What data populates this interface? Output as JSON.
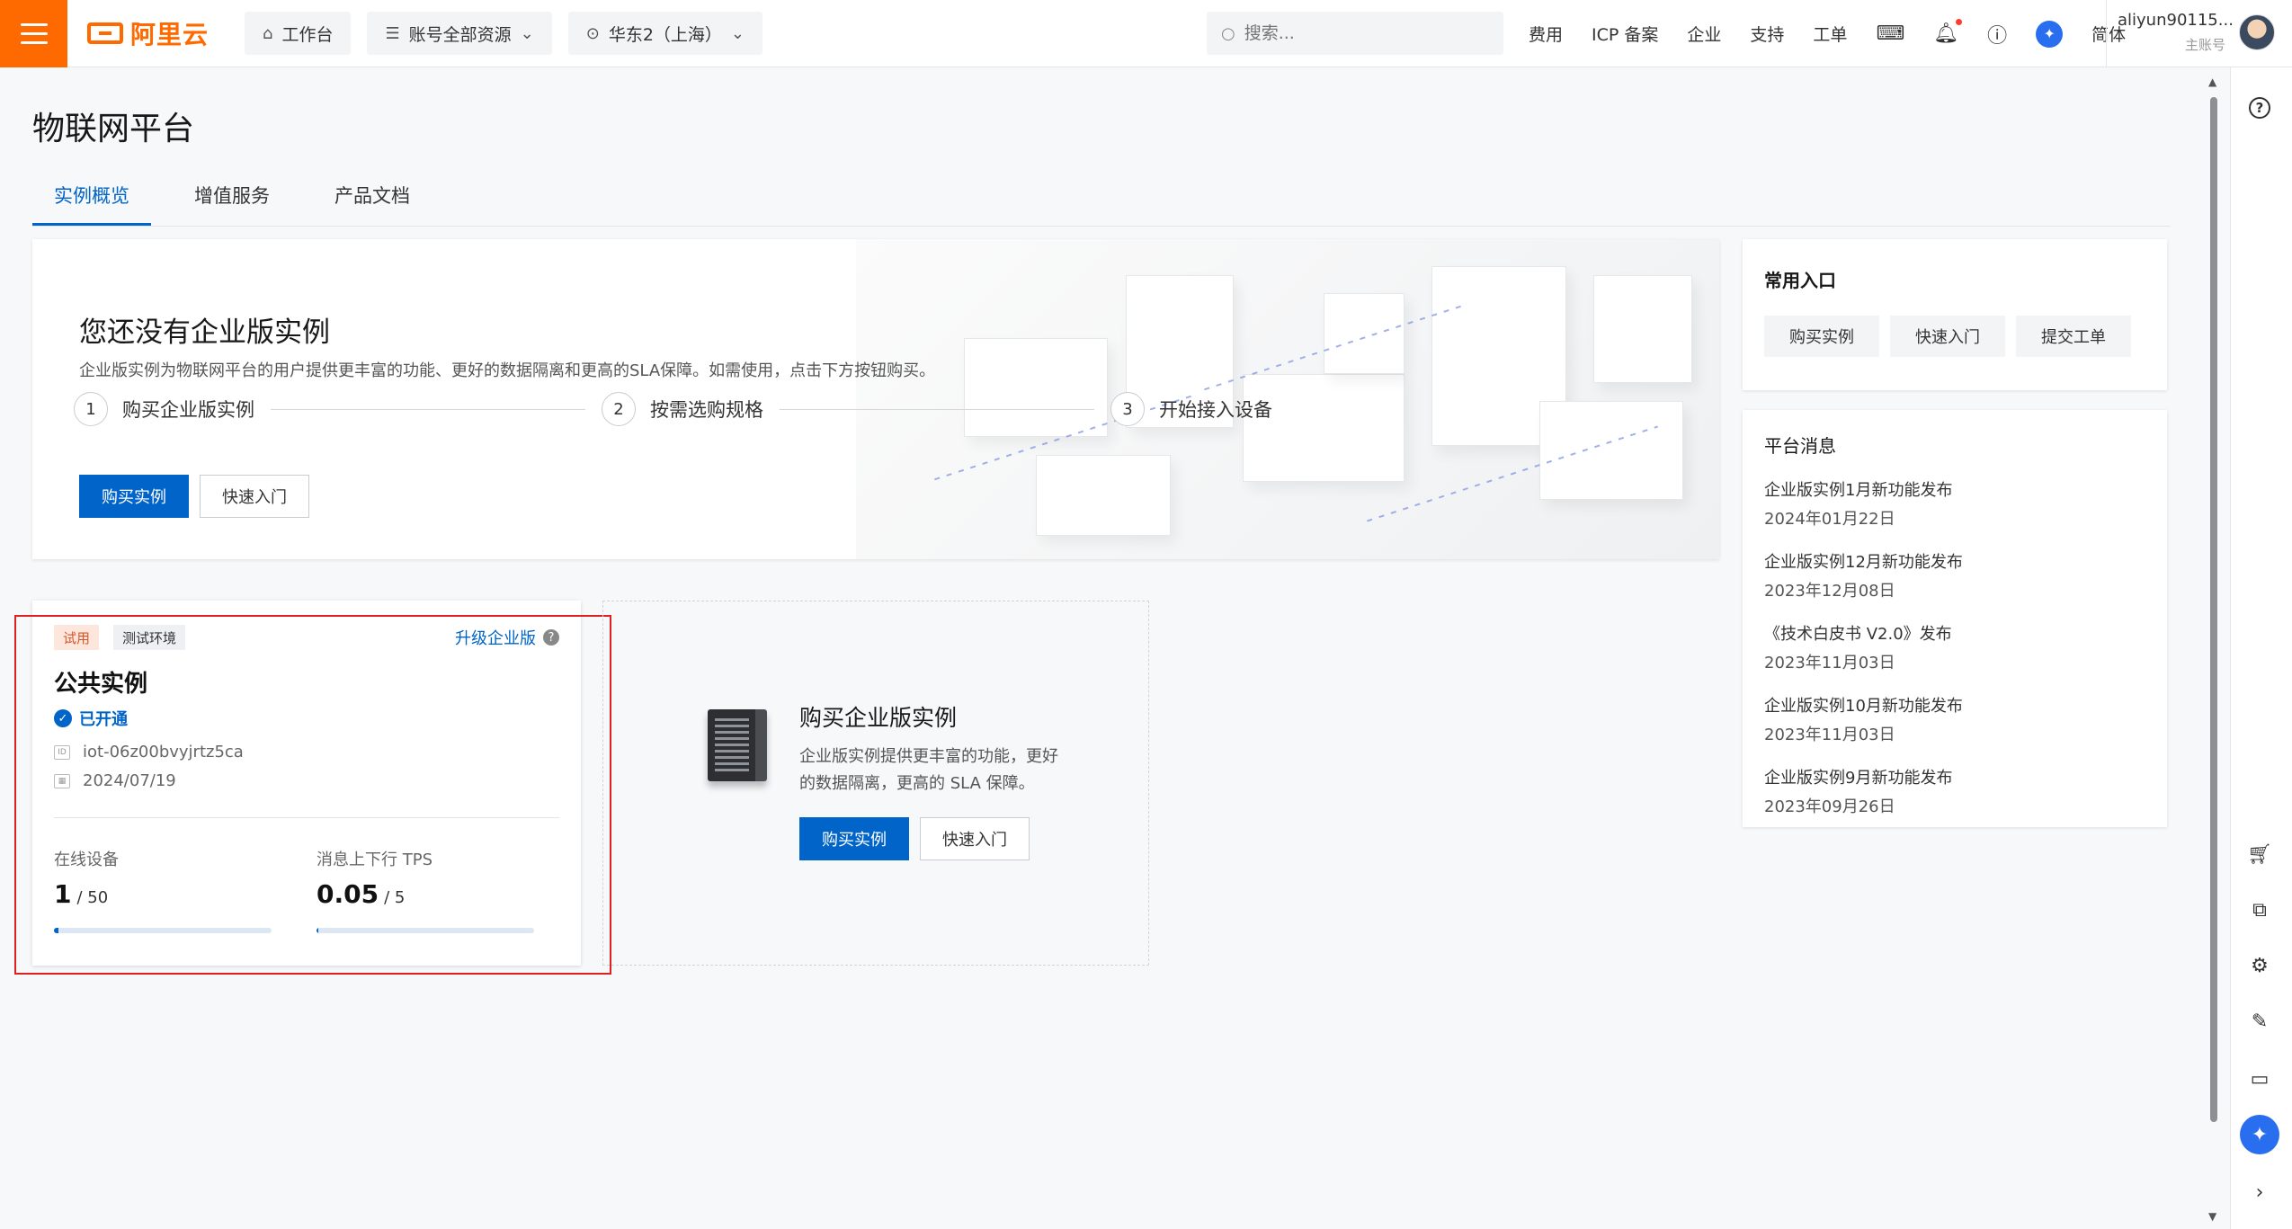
{
  "topbar": {
    "brand": "阿里云",
    "workbench": "工作台",
    "resources": "账号全部资源",
    "region": "华东2（上海）",
    "search_placeholder": "搜索...",
    "links": [
      "费用",
      "ICP 备案",
      "企业",
      "支持",
      "工单"
    ],
    "language": "简体",
    "account_name": "aliyun90115...",
    "account_role": "主账号"
  },
  "page": {
    "title": "物联网平台",
    "tabs": [
      "实例概览",
      "增值服务",
      "产品文档"
    ]
  },
  "banner": {
    "title": "您还没有企业版实例",
    "description": "企业版实例为物联网平台的用户提供更丰富的功能、更好的数据隔离和更高的SLA保障。如需使用，点击下方按钮购买。",
    "steps": [
      {
        "num": "1",
        "label": "购买企业版实例"
      },
      {
        "num": "2",
        "label": "按需选购规格"
      },
      {
        "num": "3",
        "label": "开始接入设备"
      }
    ],
    "buy_button": "购买实例",
    "quickstart_button": "快速入门"
  },
  "quick_entry": {
    "title": "常用入口",
    "buttons": [
      "购买实例",
      "快速入门",
      "提交工单"
    ]
  },
  "news": {
    "title": "平台消息",
    "items": [
      {
        "title": "企业版实例1月新功能发布",
        "date": "2024年01月22日"
      },
      {
        "title": "企业版实例12月新功能发布",
        "date": "2023年12月08日"
      },
      {
        "title": "《技术白皮书 V2.0》发布",
        "date": "2023年11月03日"
      },
      {
        "title": "企业版实例10月新功能发布",
        "date": "2023年11月03日"
      },
      {
        "title": "企业版实例9月新功能发布",
        "date": "2023年09月26日"
      }
    ]
  },
  "instance": {
    "tag_trial": "试用",
    "tag_env": "测试环境",
    "upgrade": "升级企业版",
    "name": "公共实例",
    "status": "已开通",
    "id": "iot-06z00bvyjrtz5ca",
    "date": "2024/07/19",
    "online_label": "在线设备",
    "online_value": "1",
    "online_max": "/ 50",
    "online_ratio": 0.02,
    "tps_label": "消息上下行 TPS",
    "tps_value": "0.05",
    "tps_max": "/ 5",
    "tps_ratio": 0.01
  },
  "buy_card": {
    "title": "购买企业版实例",
    "description": "企业版实例提供更丰富的功能，更好的数据隔离，更高的 SLA 保障。",
    "buy_button": "购买实例",
    "quickstart_button": "快速入门"
  },
  "colors": {
    "brand_orange": "#ff6a00",
    "primary_blue": "#0064c8",
    "highlight_red": "#e02020"
  }
}
